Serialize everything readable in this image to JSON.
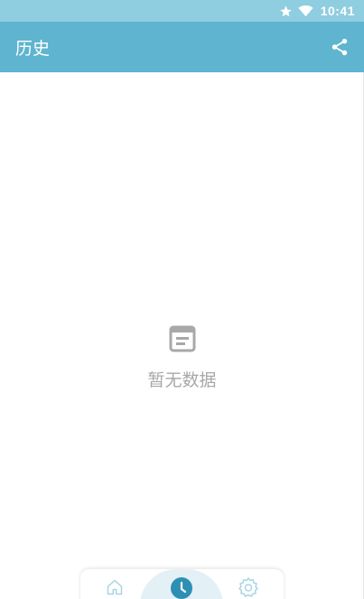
{
  "status_bar": {
    "time": "10:41",
    "icons": [
      "star-icon",
      "wifi-icon"
    ]
  },
  "app_bar": {
    "title": "历史",
    "action_icon": "share-icon"
  },
  "empty_state": {
    "icon": "document-icon",
    "text": "暂无数据"
  },
  "bottom_nav": {
    "items": [
      {
        "icon": "home-icon",
        "active": false
      },
      {
        "icon": "history-icon",
        "active": true
      },
      {
        "icon": "settings-icon",
        "active": false
      }
    ]
  },
  "colors": {
    "status_bar": "#8fcde1",
    "app_bar": "#5fb4cf",
    "accent": "#2e8fb4",
    "inactive_icon": "#a9d4e3",
    "empty_text": "#a8a8a8"
  }
}
